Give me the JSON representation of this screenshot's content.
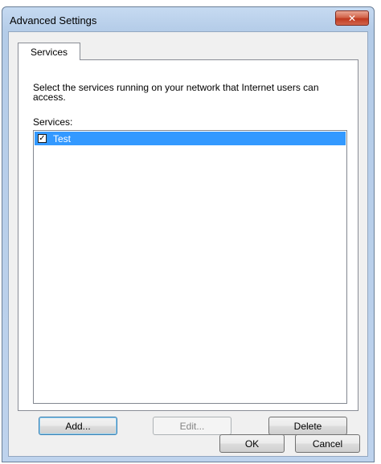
{
  "window": {
    "title": "Advanced Settings",
    "close_glyph": "✕"
  },
  "tabs": [
    {
      "label": "Services"
    }
  ],
  "panel": {
    "description": "Select the services running on your network that Internet users can access.",
    "list_label": "Services:",
    "items": [
      {
        "label": "Test",
        "checked": true,
        "selected": true
      }
    ],
    "check_glyph": "✓"
  },
  "buttons": {
    "add": "Add...",
    "edit": "Edit...",
    "delete": "Delete",
    "ok": "OK",
    "cancel": "Cancel"
  },
  "colors": {
    "selection": "#3399ff",
    "close_button": "#c0391f"
  }
}
